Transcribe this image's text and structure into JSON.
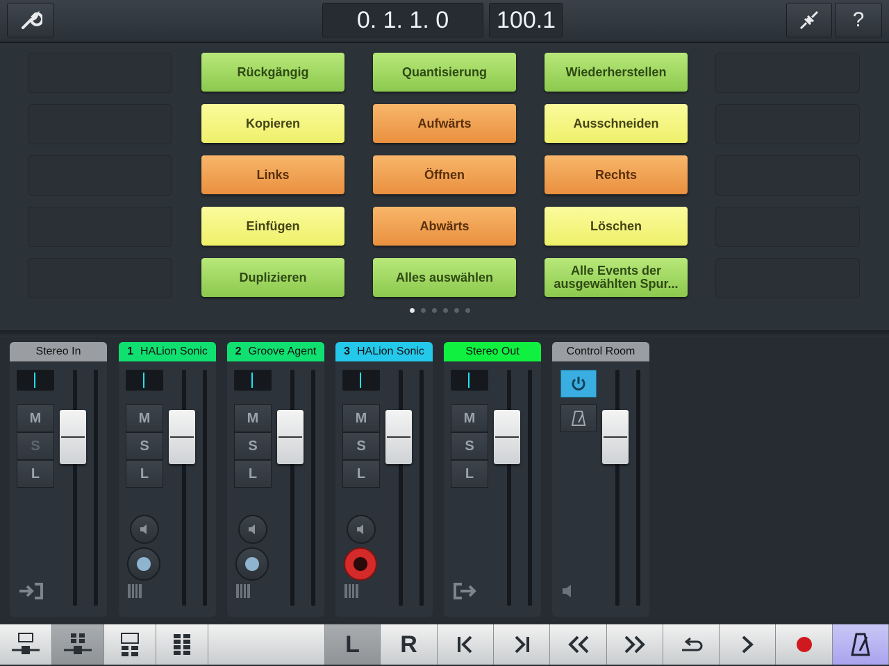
{
  "header": {
    "position_display": "0. 1. 1.  0",
    "tempo_display": "100.1",
    "icons": [
      "wrench-icon",
      "connection-icon",
      "help-icon"
    ],
    "help_label": "?"
  },
  "macros": {
    "buttons": [
      {
        "label": "Rückgängig",
        "color": "green"
      },
      {
        "label": "Quantisierung",
        "color": "green"
      },
      {
        "label": "Wiederherstellen",
        "color": "green"
      },
      {
        "label": "Kopieren",
        "color": "yellow"
      },
      {
        "label": "Aufwärts",
        "color": "orange"
      },
      {
        "label": "Ausschneiden",
        "color": "yellow"
      },
      {
        "label": "Links",
        "color": "orange"
      },
      {
        "label": "Öffnen",
        "color": "orange"
      },
      {
        "label": "Rechts",
        "color": "orange"
      },
      {
        "label": "Einfügen",
        "color": "yellow"
      },
      {
        "label": "Abwärts",
        "color": "orange"
      },
      {
        "label": "Löschen",
        "color": "yellow"
      },
      {
        "label": "Duplizieren",
        "color": "green"
      },
      {
        "label": "Alles auswählen",
        "color": "green"
      },
      {
        "label": "Alle Events der ausgewählten Spur...",
        "color": "green"
      }
    ],
    "page_count": 6,
    "current_page": 1
  },
  "colors": {
    "green": "#a4dc62",
    "yellow": "#f6f683",
    "orange": "#f0a354",
    "header_gray": "#9a9ea2",
    "header_green": "#10e070",
    "header_cyan": "#24c8ea",
    "record_red": "#d42a2a",
    "monitor_blue": "#3aaee0"
  },
  "mixer": {
    "msl_labels": [
      "M",
      "S",
      "L"
    ],
    "channels": [
      {
        "name": "Stereo In",
        "number": "",
        "header_color": "#9a9ea2"
      },
      {
        "name": "HALion Sonic",
        "number": "1",
        "header_color": "#10e070"
      },
      {
        "name": "Groove Agent",
        "number": "2",
        "header_color": "#10e070"
      },
      {
        "name": "HALion Sonic",
        "number": "3",
        "header_color": "#24c8ea"
      },
      {
        "name": "Stereo Out",
        "number": "",
        "header_color": "#10f040"
      },
      {
        "name": "Control Room",
        "number": "",
        "header_color": "#9a9ea2"
      }
    ]
  },
  "transport": {
    "left_locator": "L",
    "right_locator": "R",
    "icons": [
      "layout-arrange-icon",
      "layout-mixer-icon",
      "layout-split-icon",
      "layout-pads-icon",
      "go-to-start-icon",
      "go-to-end-icon",
      "rewind-icon",
      "forward-icon",
      "cycle-icon",
      "play-icon",
      "record-icon",
      "metronome-icon"
    ]
  }
}
